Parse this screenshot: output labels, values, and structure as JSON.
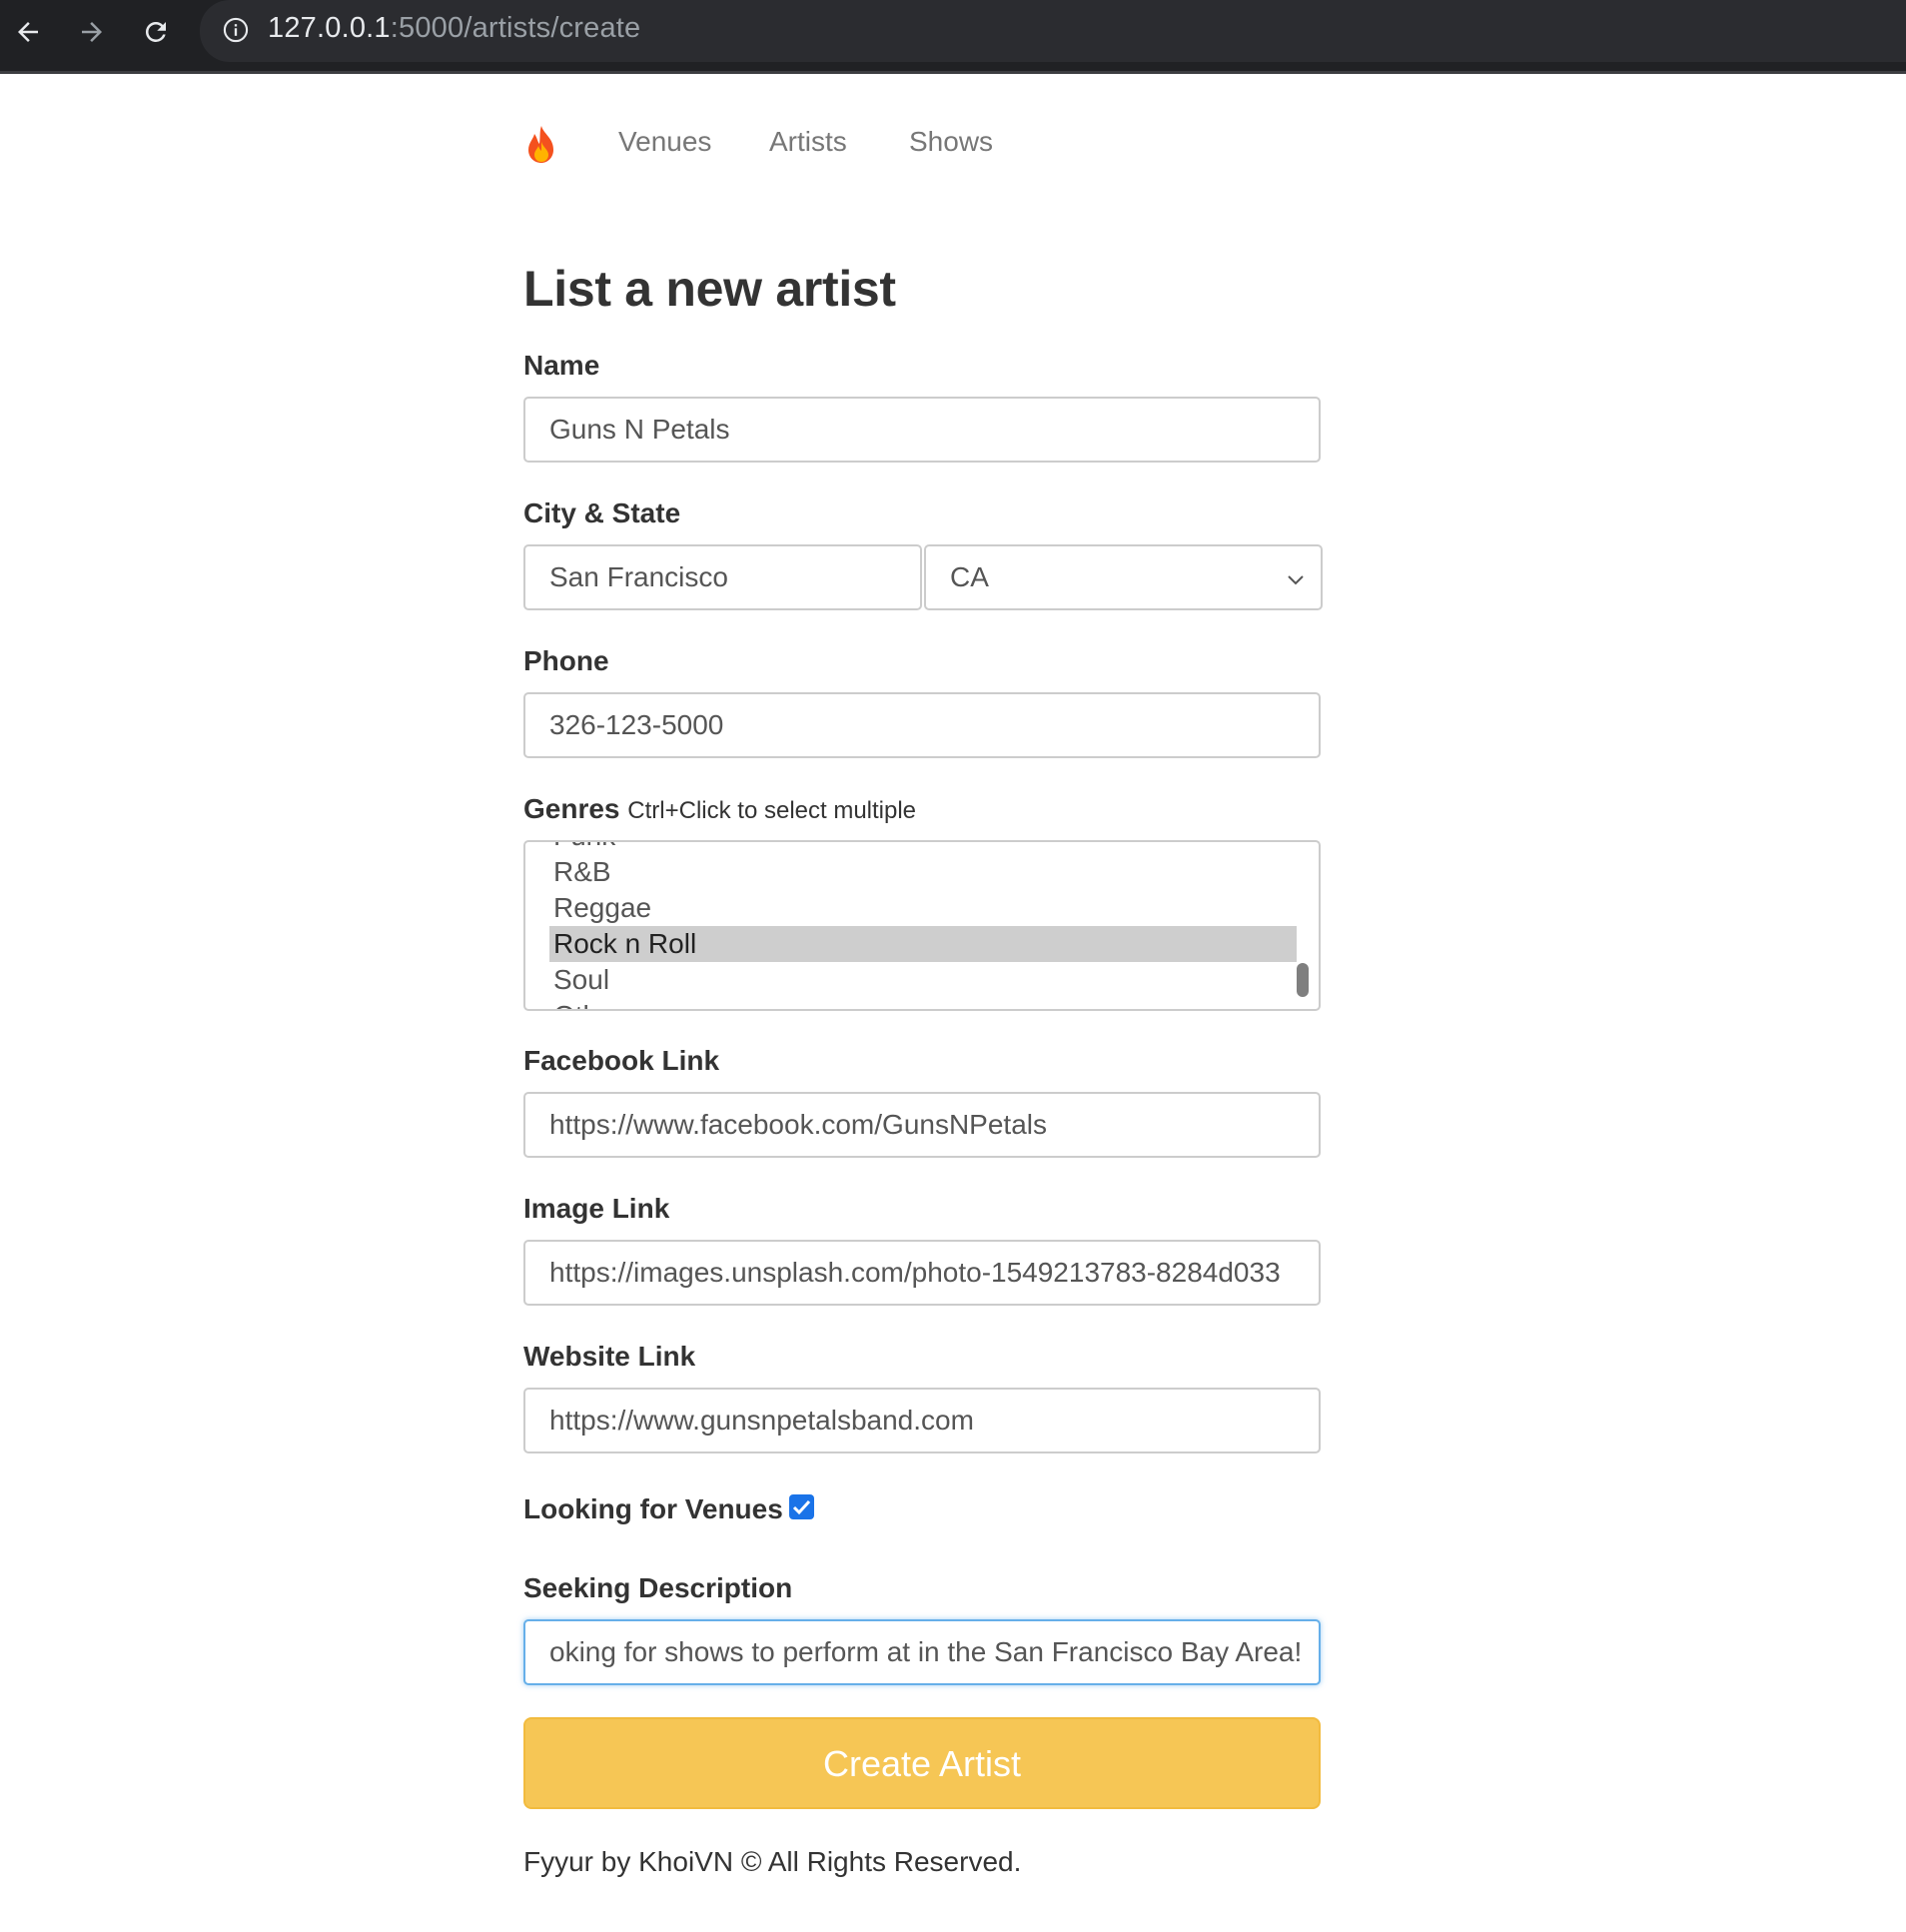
{
  "browser": {
    "url_host": "127.0.0.1",
    "url_path": ":5000/artists/create"
  },
  "navbar": {
    "links": [
      "Venues",
      "Artists",
      "Shows"
    ]
  },
  "page": {
    "title": "List a new artist"
  },
  "form": {
    "name": {
      "label": "Name",
      "value": "Guns N Petals"
    },
    "city_state": {
      "label": "City & State",
      "city_value": "San Francisco",
      "state_value": "CA"
    },
    "phone": {
      "label": "Phone",
      "value": "326-123-5000"
    },
    "genres": {
      "label": "Genres",
      "hint": "Ctrl+Click to select multiple",
      "partial_top": "Funk",
      "options": [
        "R&B",
        "Reggae",
        "Rock n Roll",
        "Soul"
      ],
      "partial_bottom": "Other",
      "selected": "Rock n Roll"
    },
    "facebook": {
      "label": "Facebook Link",
      "value": "https://www.facebook.com/GunsNPetals"
    },
    "image": {
      "label": "Image Link",
      "value": "https://images.unsplash.com/photo-1549213783-8284d033"
    },
    "website": {
      "label": "Website Link",
      "value": "https://www.gunsnpetalsband.com"
    },
    "looking": {
      "label": "Looking for Venues",
      "checked": true
    },
    "seeking": {
      "label": "Seeking Description",
      "value": "oking for shows to perform at in the San Francisco Bay Area!"
    },
    "submit_label": "Create Artist"
  },
  "footer": {
    "text": "Fyyur by KhoiVN © All Rights Reserved."
  },
  "colors": {
    "submit_bg": "#f6c655",
    "checkbox": "#1a73e8",
    "selected_option": "#cecece"
  }
}
